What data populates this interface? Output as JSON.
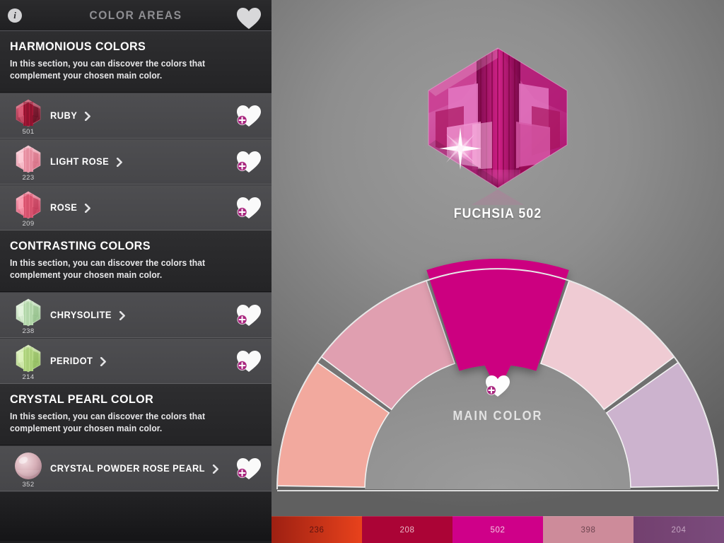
{
  "header": {
    "title": "COLOR AREAS",
    "info_icon": "info-icon",
    "favorite_icon": "heart-icon"
  },
  "sections": [
    {
      "id": "harmonious",
      "title": "HARMONIOUS COLORS",
      "description": "In this section, you can discover the colors that complement your chosen main color.",
      "items": [
        {
          "name": "RUBY",
          "code": "501",
          "bead_color": "#b2183a",
          "bead_dark": "#5d0a1d",
          "bead_light": "#e4607c",
          "icon": "bicone-bead-icon"
        },
        {
          "name": "LIGHT ROSE",
          "code": "223",
          "bead_color": "#f0a3b4",
          "bead_dark": "#d4697f",
          "bead_light": "#ffd4de",
          "icon": "bicone-bead-icon"
        },
        {
          "name": "ROSE",
          "code": "209",
          "bead_color": "#e8657f",
          "bead_dark": "#bd3352",
          "bead_light": "#ffa7ba",
          "icon": "bicone-bead-icon"
        }
      ]
    },
    {
      "id": "contrasting",
      "title": "CONTRASTING COLORS",
      "description": "In this section, you can discover the colors that complement your chosen main color.",
      "items": [
        {
          "name": "CHRYSOLITE",
          "code": "238",
          "bead_color": "#c8e6c0",
          "bead_dark": "#8fbd86",
          "bead_light": "#e9f7e4",
          "icon": "bicone-bead-icon"
        },
        {
          "name": "PERIDOT",
          "code": "214",
          "bead_color": "#bfe08f",
          "bead_dark": "#8cb758",
          "bead_light": "#e3f5c4",
          "icon": "bicone-bead-icon"
        }
      ]
    },
    {
      "id": "crystal-pearl",
      "title": "CRYSTAL PEARL COLOR",
      "description": "In this section, you can discover the colors that complement your chosen main color.",
      "items": [
        {
          "name": "CRYSTAL POWDER ROSE PEARL",
          "code": "352",
          "bead_color": "#d7b0b8",
          "bead_dark": "#a8818c",
          "bead_light": "#f3dde1",
          "icon": "pearl-bead-icon"
        }
      ]
    }
  ],
  "row_icons": {
    "chevron": "chevron-right-icon",
    "favorite": "heart-plus-icon"
  },
  "stage": {
    "crystal_label": "FUCHSIA 502",
    "crystal_icon": "bicone-crystal-icon",
    "main_color_label": "MAIN COLOR",
    "main_color_favorite_icon": "heart-plus-icon"
  },
  "chart_data": {
    "type": "pie",
    "title": "Color harmony wheel",
    "layout": "semicircle",
    "legend": "none",
    "selected_index": 2,
    "segments": [
      {
        "label": "",
        "color": "#f2a99e",
        "start_deg": 180,
        "end_deg": 216,
        "selected": false
      },
      {
        "label": "",
        "color": "#e09fb0",
        "start_deg": 216,
        "end_deg": 252,
        "selected": false
      },
      {
        "label": "",
        "color": "#ffffff",
        "start_deg": 252,
        "end_deg": 288,
        "selected": false
      },
      {
        "label": "",
        "color": "#efcbd3",
        "start_deg": 288,
        "end_deg": 324,
        "selected": false
      },
      {
        "label": "",
        "color": "#ccb3ce",
        "start_deg": 324,
        "end_deg": 360,
        "selected": false
      }
    ],
    "selected_color": "#cc0080"
  },
  "swatches": [
    {
      "code": "236",
      "color_from": "#9e2012",
      "color_to": "#e8421c",
      "text_color": "#5e1410"
    },
    {
      "code": "208",
      "color_from": "#ab0436",
      "color_to": "#ab0436",
      "text_color": "#e8b8c6"
    },
    {
      "code": "502",
      "color_from": "#cf0089",
      "color_to": "#cf0089",
      "text_color": "#f4c9e3"
    },
    {
      "code": "398",
      "color_from": "#cd8b9a",
      "color_to": "#cd8b9a",
      "text_color": "#6e4450"
    },
    {
      "code": "204",
      "color_from": "#73406f",
      "color_to": "#7a4b7c",
      "text_color": "#c3a3c0"
    }
  ]
}
